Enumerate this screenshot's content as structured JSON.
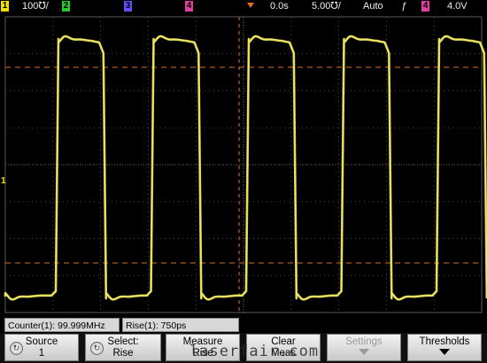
{
  "top_bar": {
    "ch1": {
      "number": "1",
      "scale": "100℧/",
      "color": "#f0e000"
    },
    "ch2": {
      "number": "2",
      "color": "#28c828"
    },
    "ch3": {
      "number": "3",
      "color": "#6050ff"
    },
    "ch4_marker": {
      "number": "4",
      "color": "#e040a0"
    },
    "time_delay": "0.0s",
    "time_scale": "5.00℧/",
    "trigger_mode": "Auto",
    "trigger_source": "4",
    "trigger_level": "4.0V"
  },
  "ground_marker": "1",
  "colors": {
    "trace": "#e8e14a",
    "grid": "#5a5a5a",
    "cursor": "#e07020"
  },
  "status": {
    "counter": "Counter(1): 99.999MHz",
    "rise": "Rise(1): 750ps"
  },
  "softkeys": {
    "source": {
      "line1": "Source",
      "line2": "1"
    },
    "select": {
      "line1": "Select:",
      "line2": "Rise"
    },
    "measure": {
      "line1": "Measure",
      "line2": "Rise"
    },
    "clear": {
      "line1": "Clear",
      "line2": "Meas"
    },
    "settings": {
      "line1": "Settings",
      "line2": ""
    },
    "thresholds": {
      "line1": "Thresholds",
      "line2": ""
    }
  },
  "watermark": "laserfair.com"
}
